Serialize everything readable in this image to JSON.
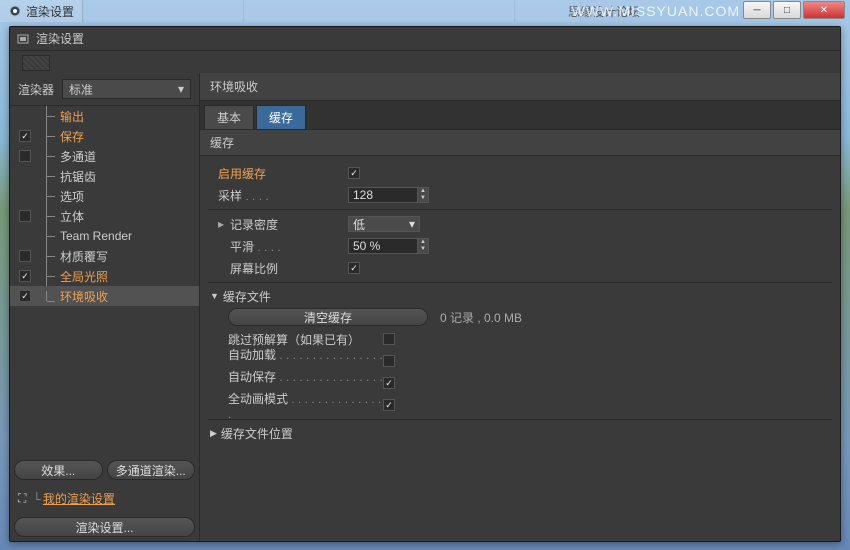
{
  "topTabs": {
    "active": "渲染设置"
  },
  "forumLabel": "思缘设计论坛",
  "watermark": "WWW.MISSYUAN.COM",
  "dialog": {
    "title": "渲染设置"
  },
  "sidebar": {
    "rendererLabel": "渲染器",
    "rendererValue": "标准",
    "items": [
      {
        "label": "输出",
        "orange": true,
        "chk": null
      },
      {
        "label": "保存",
        "orange": true,
        "chk": true
      },
      {
        "label": "多通道",
        "orange": false,
        "chk": false
      },
      {
        "label": "抗锯齿",
        "orange": false,
        "chk": null
      },
      {
        "label": "选项",
        "orange": false,
        "chk": null
      },
      {
        "label": "立体",
        "orange": false,
        "chk": false
      },
      {
        "label": "Team Render",
        "orange": false,
        "chk": null
      },
      {
        "label": "材质覆写",
        "orange": false,
        "chk": false
      },
      {
        "label": "全局光照",
        "orange": true,
        "chk": true
      },
      {
        "label": "环境吸收",
        "orange": true,
        "chk": true,
        "sel": true
      }
    ],
    "effectsBtn": "效果...",
    "multipassBtn": "多通道渲染...",
    "myPreset": "我的渲染设置",
    "renderSettingsBtn": "渲染设置..."
  },
  "main": {
    "title": "环境吸收",
    "tabs": [
      "基本",
      "缓存"
    ],
    "activeTab": 1,
    "sectionTitle": "缓存",
    "enableCache": {
      "label": "启用缓存",
      "checked": true
    },
    "samples": {
      "label": "采样",
      "value": "128"
    },
    "recordDensity": {
      "label": "记录密度",
      "value": "低"
    },
    "smooth": {
      "label": "平滑",
      "value": "50 %"
    },
    "screenRatio": {
      "label": "屏幕比例",
      "checked": true
    },
    "cacheFileGroup": "缓存文件",
    "clearBtn": "清空缓存",
    "cacheStatus": "0 记录 , 0.0 MB",
    "skipPrepass": {
      "label": "跳过预解算（如果已有）",
      "checked": false
    },
    "autoLoad": {
      "label": "自动加载",
      "checked": false
    },
    "autoSave": {
      "label": "自动保存",
      "checked": true
    },
    "fullAnim": {
      "label": "全动画模式",
      "checked": true
    },
    "cacheLocationGroup": "缓存文件位置"
  }
}
